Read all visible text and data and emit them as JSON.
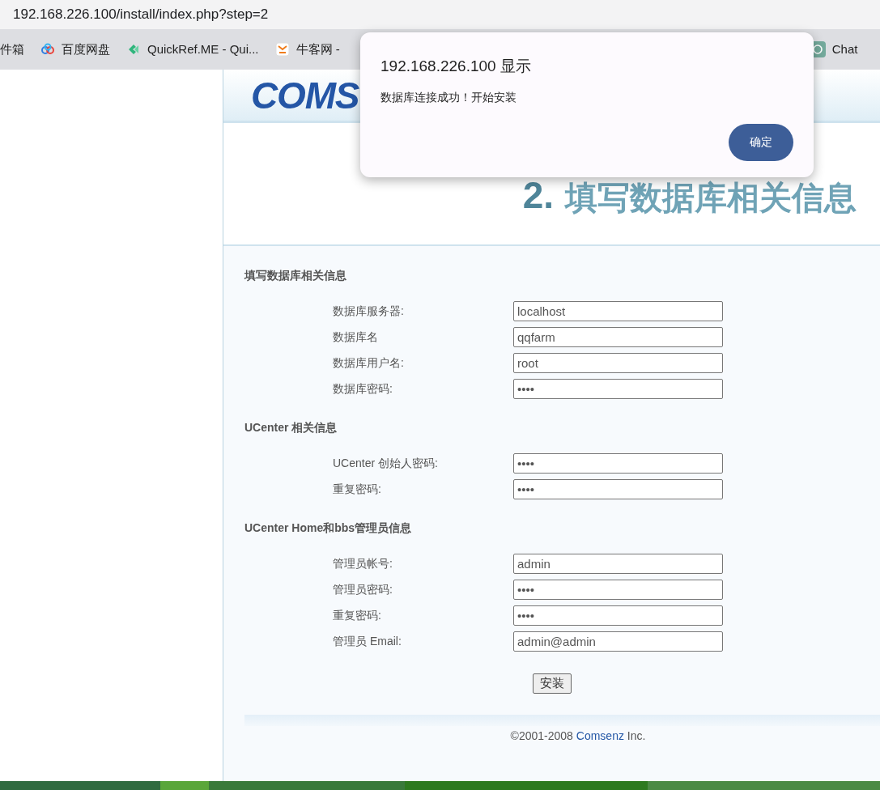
{
  "address_bar": {
    "url": "192.168.226.100/install/index.php?step=2"
  },
  "bookmarks": [
    {
      "label": "件箱",
      "kind": "none"
    },
    {
      "label": "百度网盘",
      "kind": "cloud"
    },
    {
      "label": "QuickRef.ME - Qui...",
      "kind": "quickref"
    },
    {
      "label": "牛客网 -",
      "kind": "niuke"
    },
    {
      "label": "Chat",
      "kind": "chat"
    }
  ],
  "logo": {
    "text": "COMS"
  },
  "heading": {
    "number": "2.",
    "title": "填写数据库相关信息"
  },
  "sections": [
    {
      "title": "填写数据库相关信息",
      "fields": [
        {
          "label": "数据库服务器:",
          "value": "localhost"
        },
        {
          "label": "数据库名",
          "value": "qqfarm"
        },
        {
          "label": "数据库用户名:",
          "value": "root"
        },
        {
          "label": "数据库密码:",
          "value": "••••"
        }
      ]
    },
    {
      "title": "UCenter 相关信息",
      "fields": [
        {
          "label": "UCenter 创始人密码:",
          "value": "••••"
        },
        {
          "label": "重复密码:",
          "value": "••••"
        }
      ]
    },
    {
      "title": "UCenter Home和bbs管理员信息",
      "fields": [
        {
          "label": "管理员帐号:",
          "value": "admin"
        },
        {
          "label": "管理员密码:",
          "value": "••••"
        },
        {
          "label": "重复密码:",
          "value": "••••"
        },
        {
          "label": "管理员 Email:",
          "value": "admin@admin"
        }
      ]
    }
  ],
  "install_button": "安装",
  "footer": {
    "before": "©2001-2008",
    "link": "Comsenz",
    "after": "Inc."
  },
  "dialog": {
    "title": "192.168.226.100 显示",
    "message": "数据库连接成功！开始安装",
    "button": "确定"
  }
}
